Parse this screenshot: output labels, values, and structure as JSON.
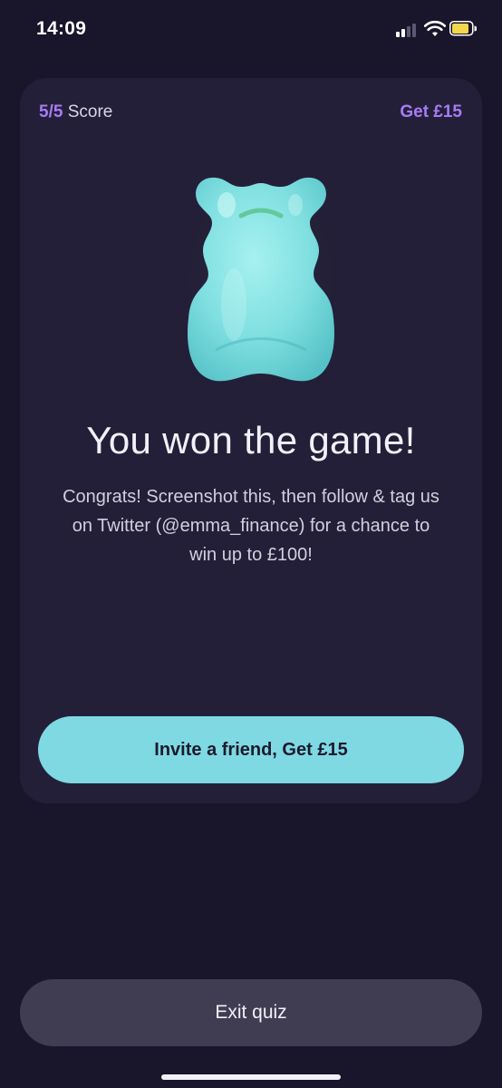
{
  "status_bar": {
    "time": "14:09"
  },
  "quiz": {
    "score_value": "5/5",
    "score_label": "Score",
    "get_link": "Get £15",
    "title": "You won the game!",
    "message": "Congrats! Screenshot this, then follow & tag us on Twitter (@emma_finance) for a chance to win up to  £100!",
    "invite_button": "Invite a friend, Get £15",
    "exit_button": "Exit quiz"
  },
  "colors": {
    "background": "#19152a",
    "card": "#241f38",
    "accent_purple": "#a67cf5",
    "accent_teal": "#7ed9e3",
    "exit_button": "#403c52"
  },
  "icons": [
    "signal-icon",
    "wifi-icon",
    "battery-icon",
    "gummy-bear-icon"
  ]
}
